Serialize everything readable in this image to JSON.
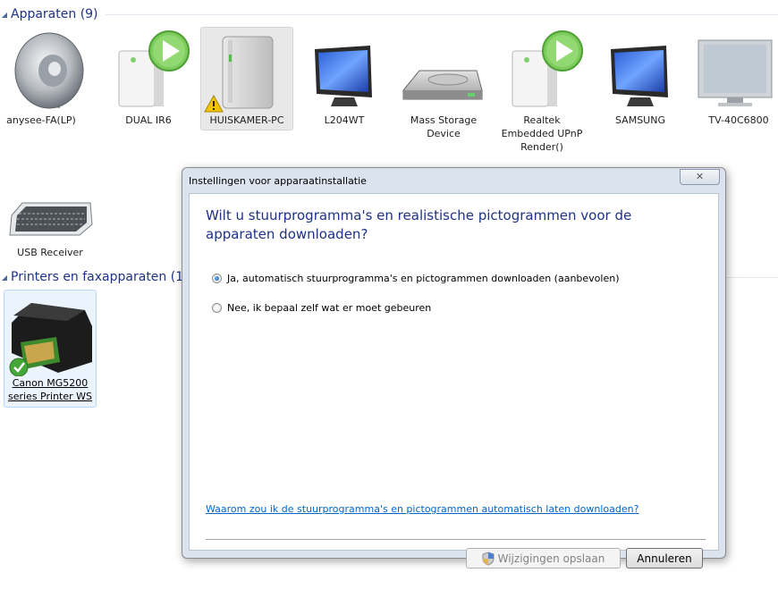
{
  "groups": {
    "devices": {
      "title": "Apparaten (9)"
    },
    "printers": {
      "title": "Printers en faxapparaten (1)"
    }
  },
  "devices": [
    {
      "label": "anysee-FA(LP)",
      "icon": "speaker-icon"
    },
    {
      "label": "DUAL IR6",
      "icon": "media-server-icon"
    },
    {
      "label": "HUISKAMER-PC",
      "icon": "pc-tower-icon",
      "status": "warning"
    },
    {
      "label": "L204WT",
      "icon": "monitor-icon"
    },
    {
      "label": "Mass Storage Device",
      "icon": "storage-drive-icon"
    },
    {
      "label": "Realtek Embedded UPnP Render()",
      "icon": "media-server-icon"
    },
    {
      "label": "SAMSUNG",
      "icon": "monitor-icon"
    },
    {
      "label": "TV-40C6800",
      "icon": "tv-icon"
    },
    {
      "label": "USB Receiver",
      "icon": "keyboard-icon"
    }
  ],
  "printers": [
    {
      "label": "Canon MG5200 series Printer WS",
      "icon": "printer-icon",
      "status": "default"
    }
  ],
  "dialog": {
    "title": "Instellingen voor apparaatinstallatie",
    "question": "Wilt u stuurprogramma's en realistische pictogrammen voor de apparaten downloaden?",
    "options": [
      {
        "label": "Ja, automatisch stuurprogramma's en pictogrammen downloaden (aanbevolen)",
        "checked": true
      },
      {
        "label": "Nee, ik bepaal zelf wat er moet gebeuren",
        "checked": false
      }
    ],
    "help_link": "Waarom zou ik de stuurprogramma's en pictogrammen automatisch laten downloaden?",
    "save_button": "Wijzigingen opslaan",
    "cancel_button": "Annuleren",
    "close_glyph": "✕"
  }
}
